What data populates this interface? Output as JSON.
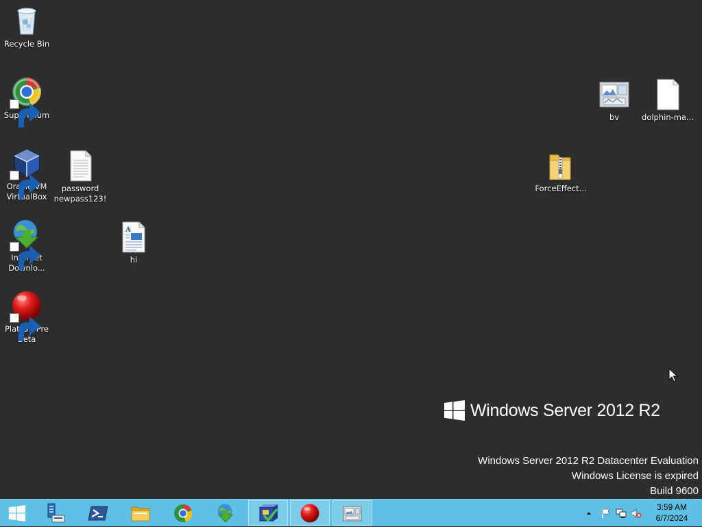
{
  "desktop": {
    "icons": [
      {
        "label": "Recycle Bin",
        "icon": "recycle-bin-icon",
        "shortcut": false
      },
      {
        "label": "Supermium",
        "icon": "supermium-browser-icon",
        "shortcut": true
      },
      {
        "label": "Oracle VM VirtualBox",
        "icon": "virtualbox-icon",
        "shortcut": true
      },
      {
        "label": "password newpass123!",
        "icon": "text-file-icon",
        "shortcut": false
      },
      {
        "label": "Internet Downlo...",
        "icon": "internet-download-manager-icon",
        "shortcut": true
      },
      {
        "label": "hi",
        "icon": "wordpad-document-icon",
        "shortcut": false
      },
      {
        "label": "PlatfOS Pre Beta",
        "icon": "red-ball-icon",
        "shortcut": true
      },
      {
        "label": "bv",
        "icon": "image-viewer-icon",
        "shortcut": false
      },
      {
        "label": "dolphin-ma...",
        "icon": "blank-file-icon",
        "shortcut": false
      },
      {
        "label": "ForceEffect...",
        "icon": "zip-folder-icon",
        "shortcut": false
      }
    ]
  },
  "branding": {
    "text": "Windows Server 2012 R2"
  },
  "watermark": {
    "line1": "Windows Server 2012 R2 Datacenter Evaluation",
    "line2": "Windows License is expired",
    "line3": "Build 9600"
  },
  "taskbar": {
    "start": "start-button",
    "pinned": [
      {
        "name": "server-manager",
        "open": false
      },
      {
        "name": "powershell",
        "open": false
      },
      {
        "name": "file-explorer",
        "open": false
      },
      {
        "name": "supermium",
        "open": false
      },
      {
        "name": "internet-download-manager",
        "open": false
      },
      {
        "name": "setup-installer",
        "open": true
      },
      {
        "name": "platfos",
        "open": true
      },
      {
        "name": "image-viewer",
        "open": true
      }
    ],
    "tray": [
      "show-hidden-icons",
      "action-center-flag-icon",
      "network-icon",
      "volume-muted-icon"
    ],
    "clock": {
      "time": "3:59 AM",
      "date": "6/7/2024"
    },
    "accent": "#5fc0e5"
  },
  "colors": {
    "desktop_bg": "#2d2d2d",
    "text": "#ffffff"
  }
}
